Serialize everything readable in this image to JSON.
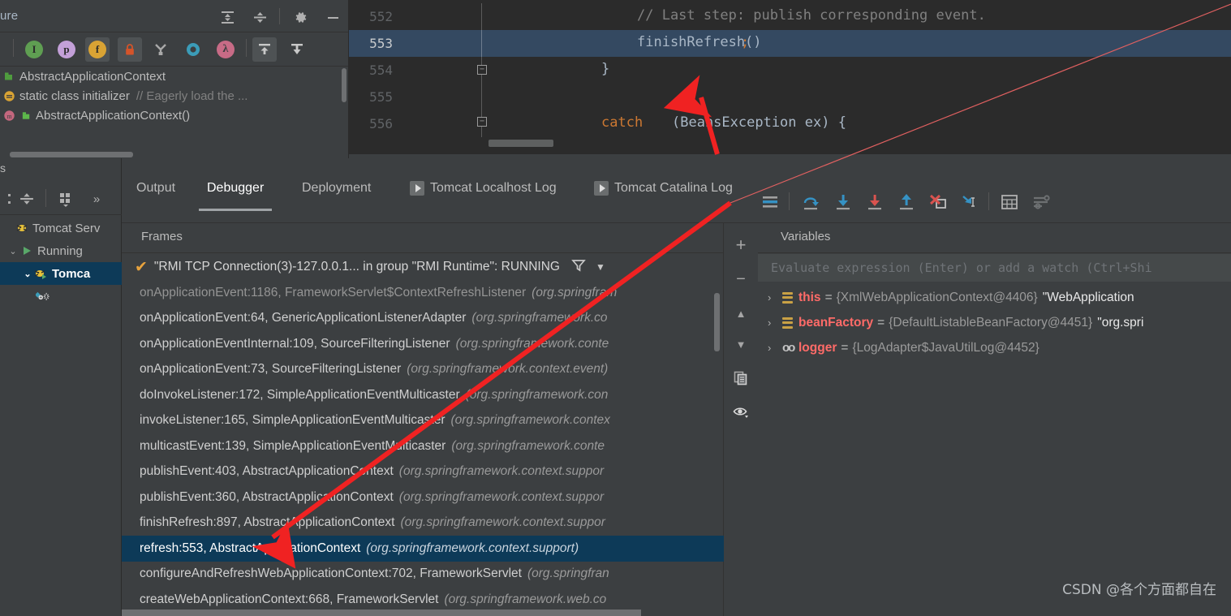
{
  "structure": {
    "title": "ure",
    "header_icons": [
      {
        "name": "expand-all-icon",
        "glyph": "expand"
      },
      {
        "name": "collapse-all-icon",
        "glyph": "collapse"
      },
      {
        "name": "settings-gear-icon",
        "glyph": "gear"
      },
      {
        "name": "hide-panel-icon",
        "glyph": "minus"
      }
    ],
    "filter_icons": [
      {
        "name": "inherited-members-icon",
        "label": "I",
        "color": "#5f9e52",
        "active": false
      },
      {
        "name": "properties-icon",
        "label": "p",
        "color": "#c3a0d8",
        "active": false
      },
      {
        "name": "fields-icon",
        "label": "f",
        "color": "#d9a334",
        "active": true
      },
      {
        "name": "non-public-icon",
        "label": "lock",
        "color": "#d4542a",
        "active": true
      },
      {
        "name": "sort-by-visibility-icon",
        "label": "Y",
        "color": "#a9a9a9",
        "active": false
      },
      {
        "name": "anonymous-classes-icon",
        "label": "O",
        "color": "#3b9cb8",
        "active": false
      },
      {
        "name": "lambdas-icon",
        "label": "λ",
        "color": "#c76b86",
        "active": false
      },
      {
        "name": "autoscroll-to-source-icon",
        "label": "up",
        "color": "#bdbdbd",
        "active": true
      },
      {
        "name": "autoscroll-from-source-icon",
        "label": "down",
        "color": "#bdbdbd",
        "active": false
      }
    ],
    "tree": [
      {
        "icon": "class-icon",
        "label": "AbstractApplicationContext",
        "comment": "",
        "indent": 0
      },
      {
        "icon": "static-initializer-icon",
        "label": "static class initializer",
        "comment": "// Eagerly load the ...",
        "indent": 0
      },
      {
        "icon": "method-icon",
        "label": "AbstractApplicationContext()",
        "comment": "",
        "indent": 1
      }
    ]
  },
  "editor": {
    "lines": [
      {
        "number": "552",
        "indent": 30,
        "highlight": false,
        "tokens": [
          {
            "t": "// Last step: publish corresponding event.",
            "c": "c-comment"
          }
        ]
      },
      {
        "number": "553",
        "indent": 30,
        "highlight": true,
        "tokens": [
          {
            "t": "finishRefresh()",
            "c": "c-plain"
          },
          {
            "t": ";",
            "c": "c-semi"
          }
        ]
      },
      {
        "number": "554",
        "indent": 0,
        "highlight": false,
        "tokens": [
          {
            "t": "}",
            "c": "c-plain"
          }
        ]
      },
      {
        "number": "555",
        "indent": 0,
        "highlight": false,
        "tokens": [
          {
            "t": "",
            "c": "c-plain"
          }
        ]
      },
      {
        "number": "556",
        "indent": 0,
        "highlight": false,
        "tokens": [
          {
            "t": "catch ",
            "c": "c-kw"
          },
          {
            "t": "(BeansException ex) {",
            "c": "c-plain"
          }
        ]
      }
    ]
  },
  "services": {
    "label": "s",
    "toolbar_icons": [
      {
        "name": "collapse-all-icon"
      },
      {
        "name": "group-by-icon"
      },
      {
        "name": "more-options-icon",
        "glyph": "»"
      }
    ],
    "tree": [
      {
        "label": "Tomcat Serv",
        "icon": "tomcat-icon",
        "chevron": "",
        "selected": false,
        "indent": 0
      },
      {
        "label": "Running",
        "icon": "run-icon",
        "chevron": "⌄",
        "selected": false,
        "indent": 1
      },
      {
        "label": "Tomca",
        "icon": "tomcat-run-icon",
        "chevron": "⌄",
        "selected": true,
        "indent": 2
      },
      {
        "label": "",
        "icon": "deployment-icon",
        "chevron": "",
        "selected": false,
        "indent": 3
      }
    ]
  },
  "debugger": {
    "tabs": [
      {
        "label": "Output",
        "active": false,
        "has_play_icon": false
      },
      {
        "label": "Debugger",
        "active": true,
        "has_play_icon": false
      },
      {
        "label": "Deployment",
        "active": false,
        "has_play_icon": false
      },
      {
        "label": "Tomcat Localhost Log",
        "active": false,
        "has_play_icon": true
      },
      {
        "label": "Tomcat Catalina Log",
        "active": false,
        "has_play_icon": true
      }
    ],
    "toolbar_buttons": [
      {
        "name": "show-execution-point-icon",
        "glyph": "lines",
        "color": "#3592c4"
      },
      {
        "name": "step-over-icon",
        "glyph": "step-over",
        "color": "#3592c4"
      },
      {
        "name": "step-into-icon",
        "glyph": "step-into",
        "color": "#3592c4"
      },
      {
        "name": "force-step-into-icon",
        "glyph": "force-step-into",
        "color": "#d9534f"
      },
      {
        "name": "step-out-icon",
        "glyph": "step-out",
        "color": "#3592c4"
      },
      {
        "name": "drop-frame-icon",
        "glyph": "drop-frame",
        "color": "#d9534f"
      },
      {
        "name": "run-to-cursor-icon",
        "glyph": "run-to-cursor",
        "color": "#3592c4"
      },
      {
        "name": "evaluate-expression-icon",
        "glyph": "calculator",
        "color": "#b0b0b0"
      },
      {
        "name": "settings-icon",
        "glyph": "sliders",
        "color": "#6d7072"
      }
    ],
    "frames": {
      "title": "Frames",
      "thread": "\"RMI TCP Connection(3)-127.0.0.1... in group \"RMI Runtime\": RUNNING",
      "filter_icon": "filter-icon",
      "dropdown_icon": "chevron-down-icon",
      "rows": [
        {
          "method": "onApplicationEvent:1186, FrameworkServlet$ContextRefreshListener",
          "package": "(org.springfram",
          "dim": true,
          "selected": false
        },
        {
          "method": "onApplicationEvent:64, GenericApplicationListenerAdapter",
          "package": "(org.springframework.co",
          "dim": false,
          "selected": false
        },
        {
          "method": "onApplicationEventInternal:109, SourceFilteringListener",
          "package": "(org.springframework.conte",
          "dim": false,
          "selected": false
        },
        {
          "method": "onApplicationEvent:73, SourceFilteringListener",
          "package": "(org.springframework.context.event)",
          "dim": false,
          "selected": false
        },
        {
          "method": "doInvokeListener:172, SimpleApplicationEventMulticaster",
          "package": "(org.springframework.con",
          "dim": false,
          "selected": false
        },
        {
          "method": "invokeListener:165, SimpleApplicationEventMulticaster",
          "package": "(org.springframework.contex",
          "dim": false,
          "selected": false
        },
        {
          "method": "multicastEvent:139, SimpleApplicationEventMulticaster",
          "package": "(org.springframework.conte",
          "dim": false,
          "selected": false
        },
        {
          "method": "publishEvent:403, AbstractApplicationContext",
          "package": "(org.springframework.context.suppor",
          "dim": false,
          "selected": false
        },
        {
          "method": "publishEvent:360, AbstractApplicationContext",
          "package": "(org.springframework.context.suppor",
          "dim": false,
          "selected": false
        },
        {
          "method": "finishRefresh:897, AbstractApplicationContext",
          "package": "(org.springframework.context.suppor",
          "dim": false,
          "selected": false
        },
        {
          "method": "refresh:553, AbstractApplicationContext",
          "package": "(org.springframework.context.support)",
          "dim": false,
          "selected": true
        },
        {
          "method": "configureAndRefreshWebApplicationContext:702, FrameworkServlet",
          "package": "(org.springfran",
          "dim": false,
          "selected": false
        },
        {
          "method": "createWebApplicationContext:668, FrameworkServlet",
          "package": "(org.springframework.web.co",
          "dim": false,
          "selected": false
        }
      ]
    },
    "watch_buttons": [
      {
        "name": "add-watch-button",
        "glyph": "+"
      },
      {
        "name": "remove-watch-button",
        "glyph": "−"
      },
      {
        "name": "move-watch-up-button",
        "glyph": "▲"
      },
      {
        "name": "move-watch-down-button",
        "glyph": "▼"
      },
      {
        "name": "copy-value-button",
        "glyph": "copy"
      },
      {
        "name": "inspect-value-button",
        "glyph": "eye"
      }
    ],
    "variables": {
      "title": "Variables",
      "eval_placeholder": "Evaluate expression (Enter) or add a watch (Ctrl+Shi",
      "rows": [
        {
          "icon": "stack-icon",
          "name": "this",
          "value": "{XmlWebApplicationContext@4406}",
          "string": "\"WebApplication",
          "chevron": "›"
        },
        {
          "icon": "stack-icon",
          "name": "beanFactory",
          "value": "{DefaultListableBeanFactory@4451}",
          "string": "\"org.spri",
          "chevron": "›"
        },
        {
          "icon": "oo-icon",
          "name": "logger",
          "value": "{LogAdapter$JavaUtilLog@4452}",
          "string": "",
          "chevron": "›"
        }
      ]
    }
  },
  "annotation": {
    "arrow_color": "#f02222",
    "thin_line_color": "#e06060"
  },
  "watermark": "CSDN @各个方面都自在"
}
